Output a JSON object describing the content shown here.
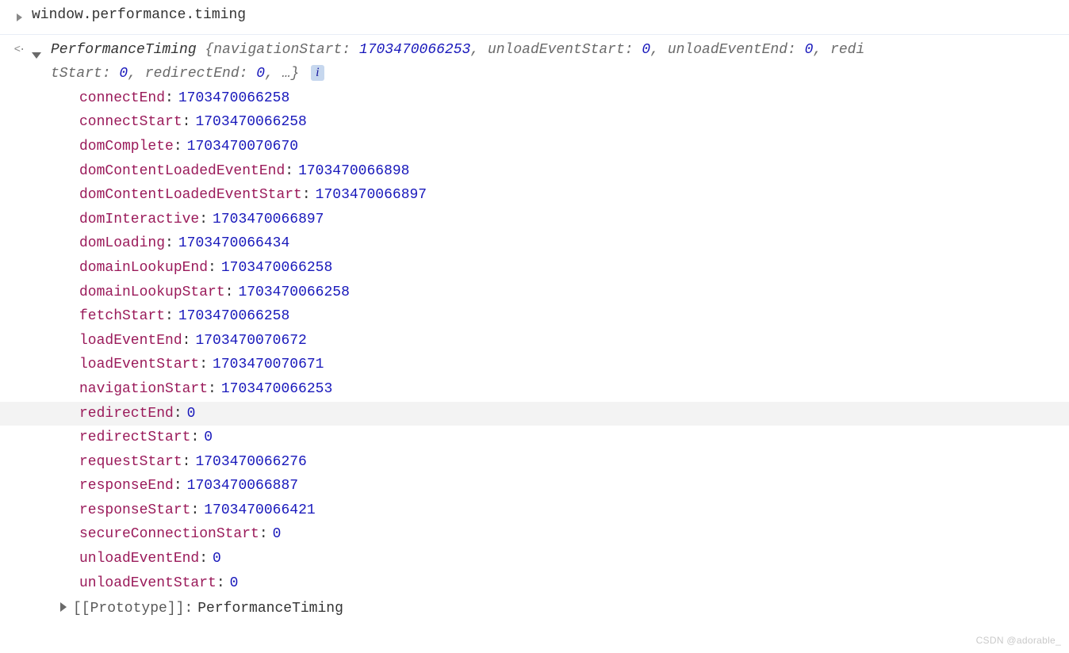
{
  "console": {
    "command": "window.performance.timing",
    "output_indicator": "<·"
  },
  "object": {
    "type_name": "PerformanceTiming",
    "summary_pairs": [
      {
        "key": "navigationStart",
        "value": "1703470066253"
      },
      {
        "key": "unloadEventStart",
        "value": "0"
      },
      {
        "key": "unloadEventEnd",
        "value": "0"
      },
      {
        "key": "redirectStart",
        "value": "0",
        "truncated_key": "redi\ntStart"
      },
      {
        "key": "redirectEnd",
        "value": "0"
      }
    ],
    "summary_ellipsis": "…",
    "info_badge": "i"
  },
  "properties": [
    {
      "key": "connectEnd",
      "value": "1703470066258"
    },
    {
      "key": "connectStart",
      "value": "1703470066258"
    },
    {
      "key": "domComplete",
      "value": "1703470070670"
    },
    {
      "key": "domContentLoadedEventEnd",
      "value": "1703470066898"
    },
    {
      "key": "domContentLoadedEventStart",
      "value": "1703470066897"
    },
    {
      "key": "domInteractive",
      "value": "1703470066897"
    },
    {
      "key": "domLoading",
      "value": "1703470066434"
    },
    {
      "key": "domainLookupEnd",
      "value": "1703470066258"
    },
    {
      "key": "domainLookupStart",
      "value": "1703470066258"
    },
    {
      "key": "fetchStart",
      "value": "1703470066258"
    },
    {
      "key": "loadEventEnd",
      "value": "1703470070672"
    },
    {
      "key": "loadEventStart",
      "value": "1703470070671"
    },
    {
      "key": "navigationStart",
      "value": "1703470066253"
    },
    {
      "key": "redirectEnd",
      "value": "0",
      "highlight": true
    },
    {
      "key": "redirectStart",
      "value": "0"
    },
    {
      "key": "requestStart",
      "value": "1703470066276"
    },
    {
      "key": "responseEnd",
      "value": "1703470066887"
    },
    {
      "key": "responseStart",
      "value": "1703470066421"
    },
    {
      "key": "secureConnectionStart",
      "value": "0"
    },
    {
      "key": "unloadEventEnd",
      "value": "0"
    },
    {
      "key": "unloadEventStart",
      "value": "0"
    }
  ],
  "prototype": {
    "label": "[[Prototype]]",
    "value": "PerformanceTiming"
  },
  "watermark": "CSDN @adorable_"
}
